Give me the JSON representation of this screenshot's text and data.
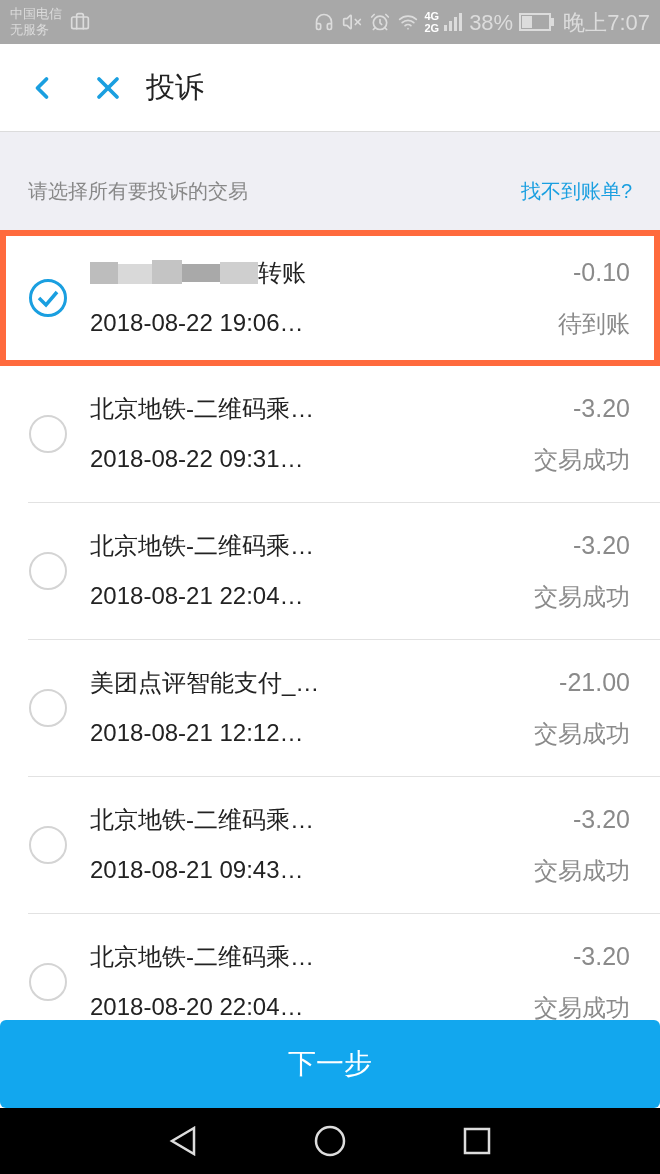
{
  "status_bar": {
    "carrier": "中国电信",
    "service": "无服务",
    "network": "4G",
    "network2": "2G",
    "battery": "38%",
    "time": "晚上7:07"
  },
  "header": {
    "title": "投诉"
  },
  "hint": "请选择所有要投诉的交易",
  "help_link": "找不到账单?",
  "transactions": [
    {
      "title": "转账",
      "redacted": true,
      "date": "2018-08-22 19:06…",
      "amount": "-0.10",
      "status": "待到账",
      "selected": true,
      "highlighted": true
    },
    {
      "title": "北京地铁-二维码乘…",
      "redacted": false,
      "date": "2018-08-22 09:31…",
      "amount": "-3.20",
      "status": "交易成功",
      "selected": false,
      "highlighted": false
    },
    {
      "title": "北京地铁-二维码乘…",
      "redacted": false,
      "date": "2018-08-21 22:04…",
      "amount": "-3.20",
      "status": "交易成功",
      "selected": false,
      "highlighted": false
    },
    {
      "title": "美团点评智能支付_…",
      "redacted": false,
      "date": "2018-08-21 12:12…",
      "amount": "-21.00",
      "status": "交易成功",
      "selected": false,
      "highlighted": false
    },
    {
      "title": "北京地铁-二维码乘…",
      "redacted": false,
      "date": "2018-08-21 09:43…",
      "amount": "-3.20",
      "status": "交易成功",
      "selected": false,
      "highlighted": false
    },
    {
      "title": "北京地铁-二维码乘…",
      "redacted": false,
      "date": "2018-08-20 22:04…",
      "amount": "-3.20",
      "status": "交易成功",
      "selected": false,
      "highlighted": false
    }
  ],
  "next_button": "下一步"
}
